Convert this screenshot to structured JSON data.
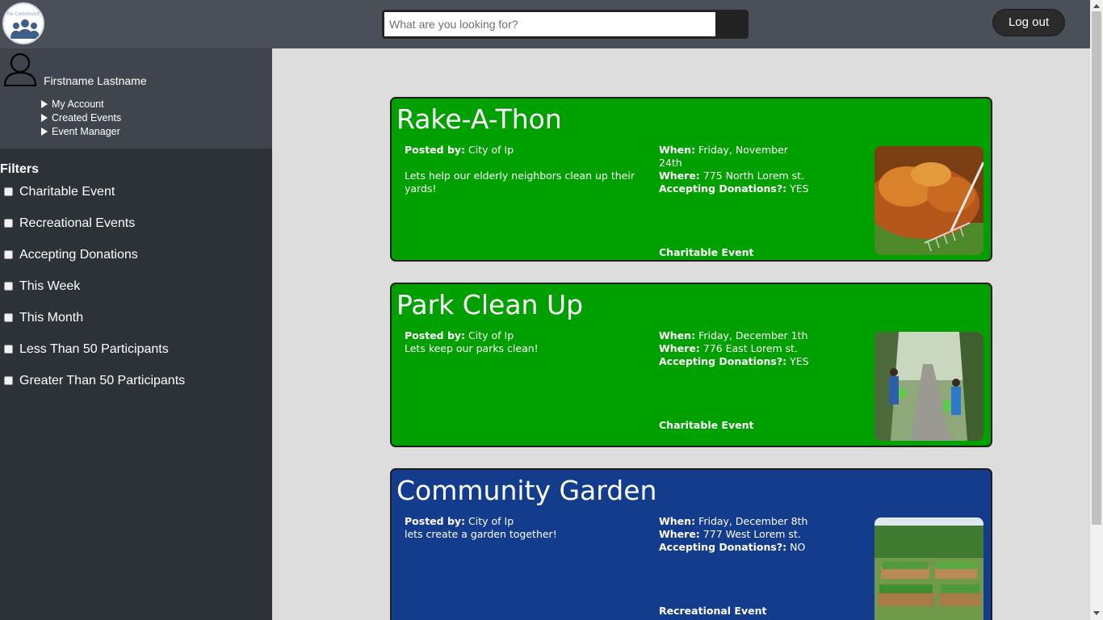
{
  "header": {
    "logo_text": "The Community",
    "search_placeholder": "What are you looking for?",
    "search_value": "",
    "logout_label": "Log out"
  },
  "sidebar": {
    "user_name": "Firstname Lastname",
    "links": [
      {
        "label": "My Account"
      },
      {
        "label": "Created Events"
      },
      {
        "label": "Event Manager"
      }
    ],
    "filters_title": "Filters",
    "filters": [
      {
        "label": "Charitable Event",
        "checked": false
      },
      {
        "label": "Recreational Events",
        "checked": false
      },
      {
        "label": "Accepting Donations",
        "checked": false
      },
      {
        "label": "This Week",
        "checked": false
      },
      {
        "label": "This Month",
        "checked": false
      },
      {
        "label": "Less Than 50 Participants",
        "checked": false
      },
      {
        "label": "Greater Than 50 Participants",
        "checked": false
      }
    ]
  },
  "labels": {
    "posted_by": "Posted by:",
    "when": "When:",
    "where": "Where:",
    "donations": "Accepting Donations?:"
  },
  "events": [
    {
      "title": "Rake-A-Thon",
      "posted_by": "City of Ip",
      "description": "Lets help our elderly neighbors clean up their yards!",
      "when": "Friday, November 24th",
      "where": "775 North Lorem st.",
      "donations": "YES",
      "category": "Charitable Event",
      "color": "#00a000",
      "image": "fallen-leaves-with-rake"
    },
    {
      "title": "Park Clean Up",
      "posted_by": "City of Ip",
      "description": "Lets keep our parks clean!",
      "when": "Friday, December 1th",
      "where": "776 East Lorem st.",
      "donations": "YES",
      "category": "Charitable Event",
      "color": "#00a000",
      "image": "volunteers-cleaning-park-path"
    },
    {
      "title": "Community Garden",
      "posted_by": "City of Ip",
      "description": "lets create a garden together!",
      "when": "Friday, December 8th",
      "where": "777 West Lorem st.",
      "donations": "NO",
      "category": "Recreational Event",
      "color": "#143c8c",
      "image": "raised-garden-beds"
    }
  ]
}
